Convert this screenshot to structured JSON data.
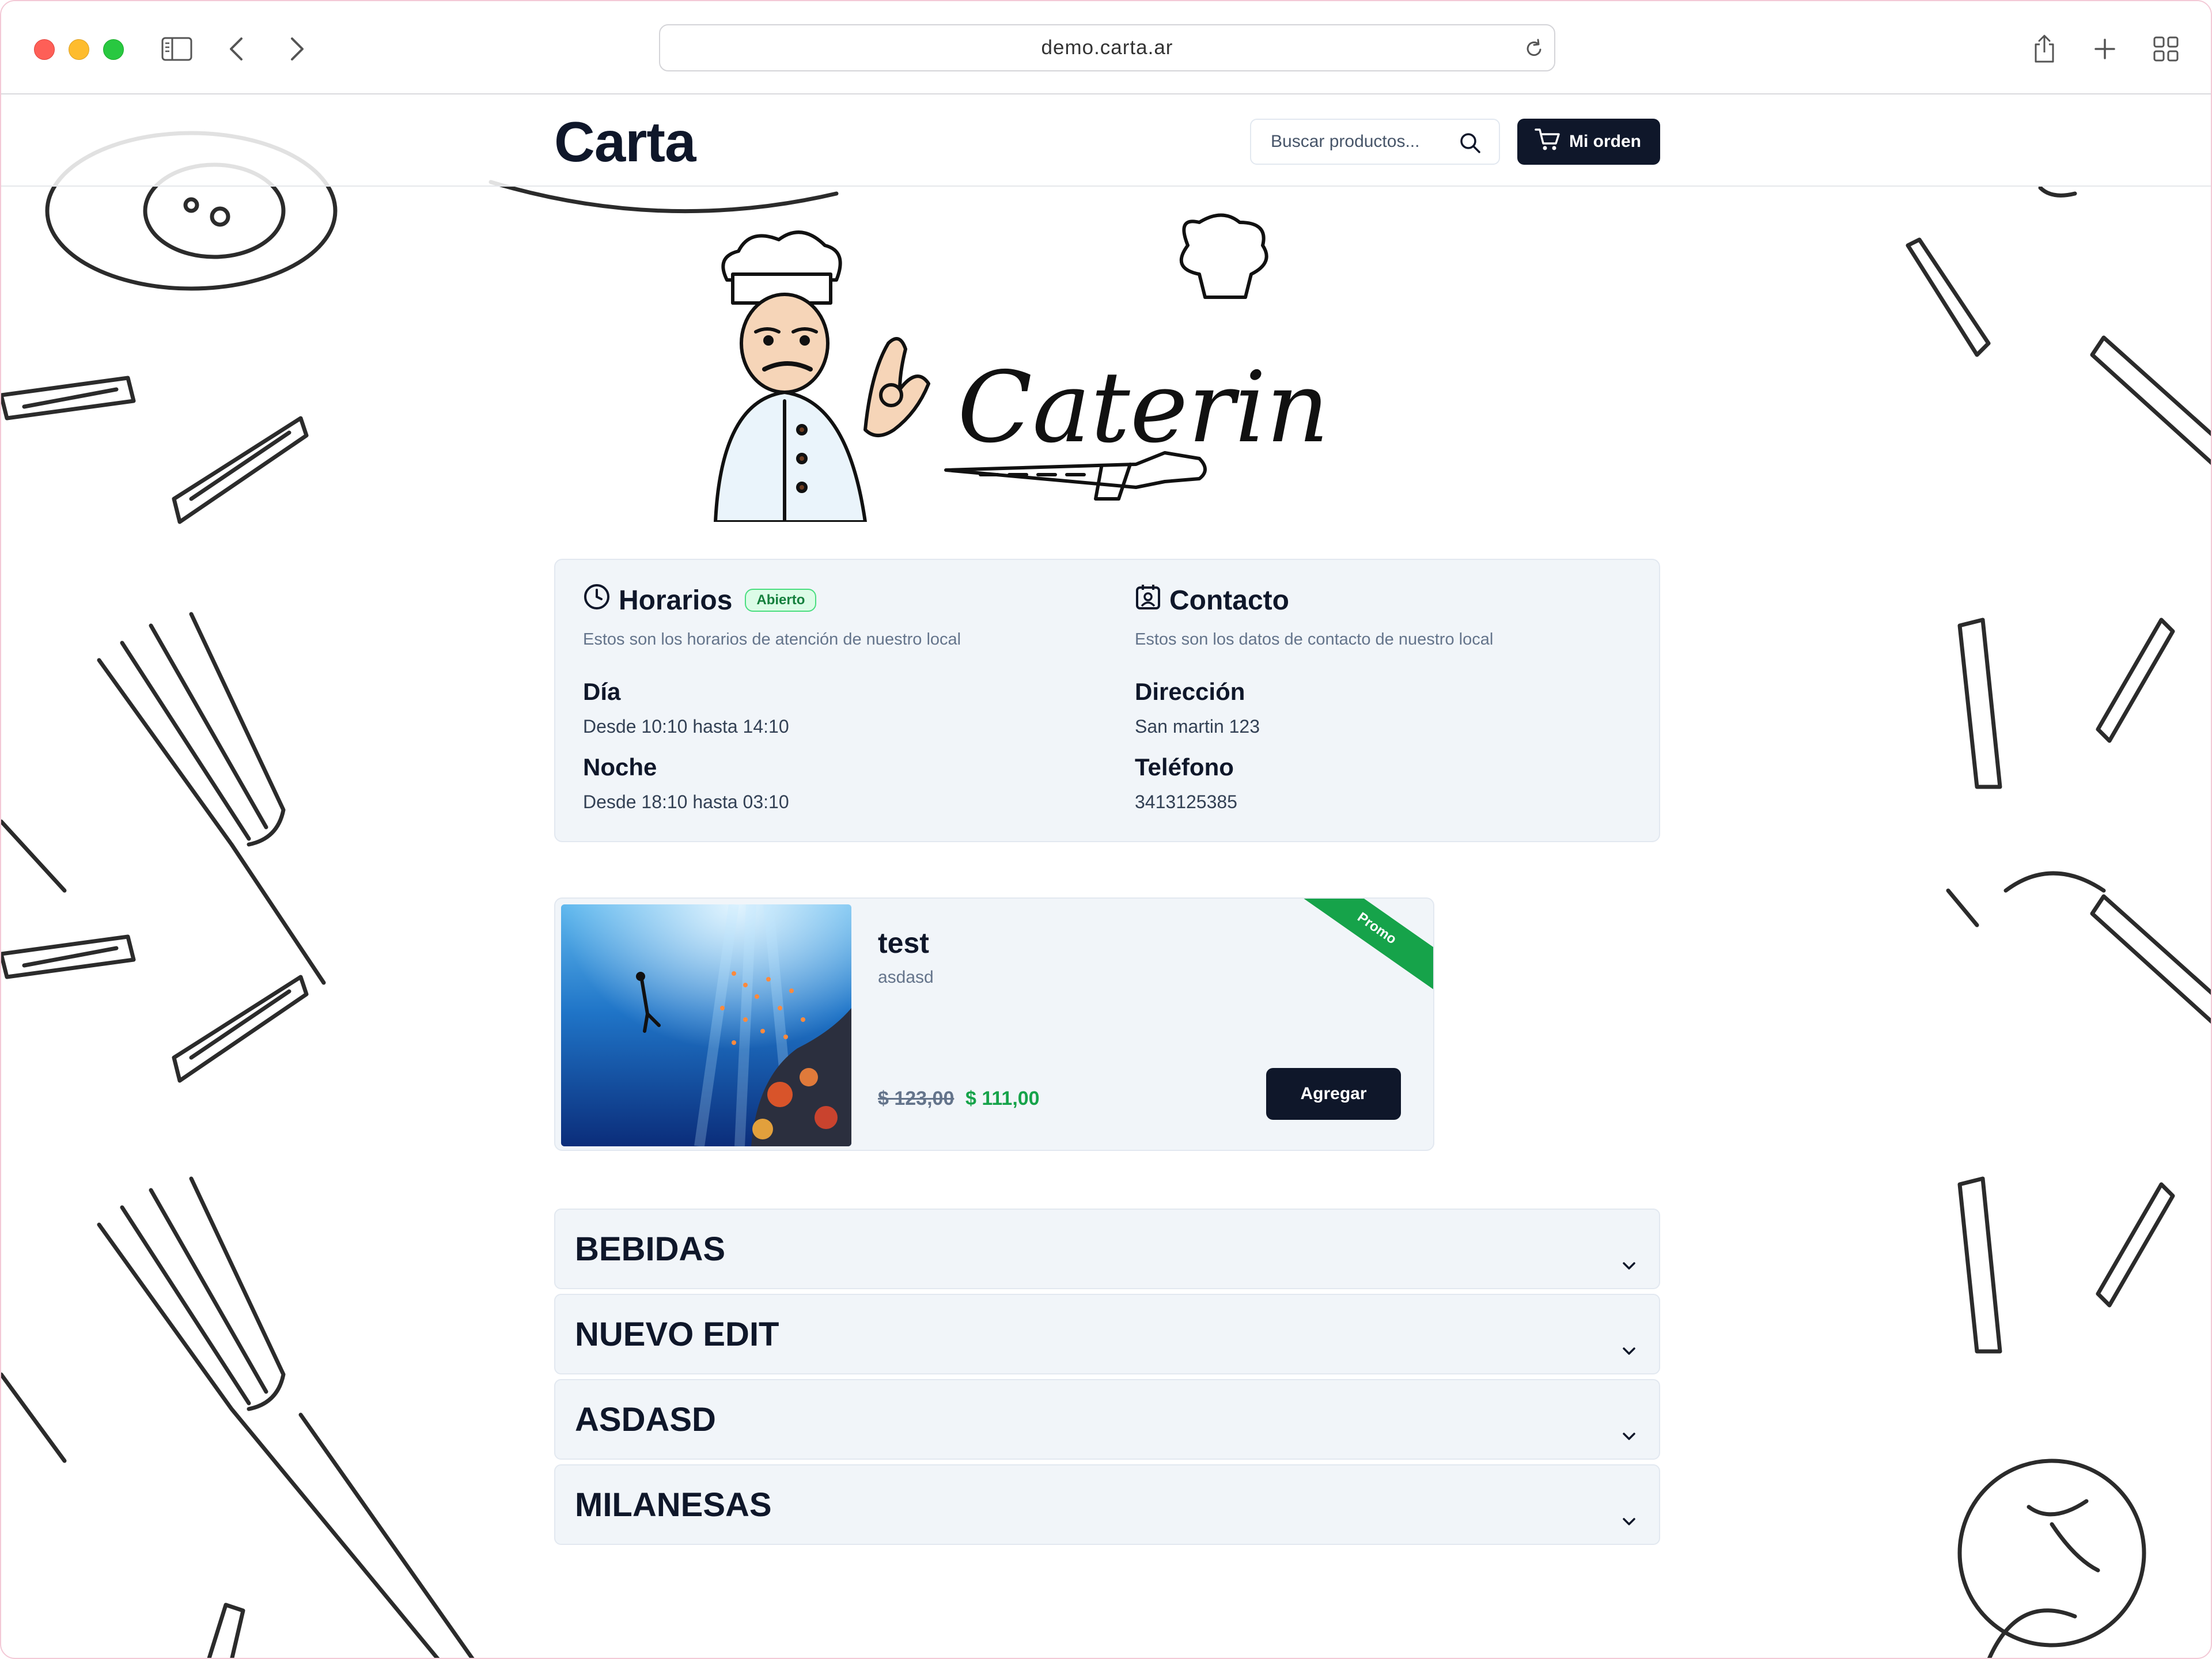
{
  "browser": {
    "url": "demo.carta.ar"
  },
  "navbar": {
    "brand": "Carta",
    "search_placeholder": "Buscar productos...",
    "order_label": "Mi orden"
  },
  "hero": {
    "logo_text": "Catering"
  },
  "info": {
    "horarios": {
      "title": "Horarios",
      "status_badge": "Abierto",
      "subtitle": "Estos son los horarios de atención de nuestro local",
      "items": [
        {
          "label": "Día",
          "value": "Desde 10:10 hasta 14:10"
        },
        {
          "label": "Noche",
          "value": "Desde 18:10 hasta 03:10"
        }
      ]
    },
    "contacto": {
      "title": "Contacto",
      "subtitle": "Estos son los datos de contacto de nuestro local",
      "items": [
        {
          "label": "Dirección",
          "value": "San martin 123"
        },
        {
          "label": "Teléfono",
          "value": "3413125385"
        }
      ]
    }
  },
  "promo_product": {
    "ribbon": "Promo",
    "title": "test",
    "description": "asdasd",
    "old_price": "$ 123,00",
    "new_price": "$ 111,00",
    "add_label": "Agregar"
  },
  "categories": [
    {
      "label": "BEBIDAS"
    },
    {
      "label": "NUEVO EDIT"
    },
    {
      "label": "ASDASD"
    },
    {
      "label": "MILANESAS"
    }
  ],
  "colors": {
    "accent_dark": "#0f172a",
    "success": "#16a34a",
    "card_bg": "#f1f5f9"
  }
}
